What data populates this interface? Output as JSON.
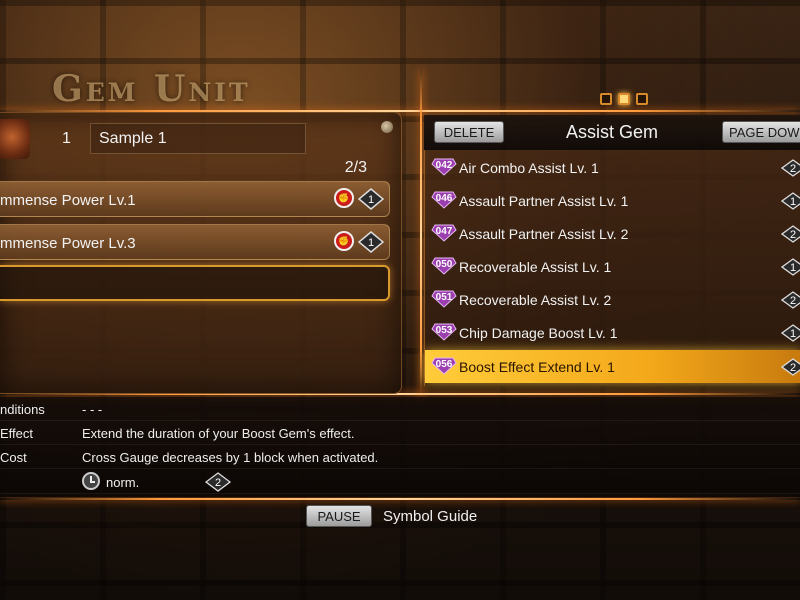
{
  "screen_title": "Gem Unit",
  "set": {
    "number": "1",
    "name": "Sample 1",
    "count": "2/3",
    "slots": [
      {
        "label": "mmense Power Lv.1",
        "cost": "1"
      },
      {
        "label": "mmense Power Lv.3",
        "cost": "1"
      }
    ]
  },
  "assist": {
    "title": "Assist Gem",
    "delete_label": "DELETE",
    "page_down_label": "PAGE DOWN",
    "items": [
      {
        "num": "042",
        "name": "Air Combo Assist Lv. 1",
        "cost": "2"
      },
      {
        "num": "046",
        "name": "Assault Partner Assist Lv. 1",
        "cost": "1"
      },
      {
        "num": "047",
        "name": "Assault Partner Assist Lv. 2",
        "cost": "2"
      },
      {
        "num": "050",
        "name": "Recoverable Assist Lv. 1",
        "cost": "1"
      },
      {
        "num": "051",
        "name": "Recoverable Assist Lv. 2",
        "cost": "2"
      },
      {
        "num": "053",
        "name": "Chip Damage Boost Lv. 1",
        "cost": "1"
      },
      {
        "num": "056",
        "name": "Boost Effect Extend Lv. 1",
        "cost": "2"
      }
    ],
    "selected_index": 6
  },
  "info": {
    "conditions_label": "nditions",
    "conditions_value": "- - -",
    "effect_label": "Effect",
    "effect_value": "Extend the duration of your Boost Gem's effect.",
    "cost_label": "Cost",
    "cost_value": "Cross Gauge decreases by 1 block when activated.",
    "speed_value": "norm.",
    "gem_cost": "2"
  },
  "footer": {
    "pause_label": "PAUSE",
    "guide_label": "Symbol Guide"
  },
  "colors": {
    "accent": "#ff9a3c",
    "selected": "#ffcc3a",
    "gem_purple": "#9b3fb0",
    "category_red": "#cc1b1b"
  },
  "icons": {
    "gem": "purple-gem-icon",
    "cost": "diamond-cost-icon",
    "category": "fist-category-icon",
    "speed": "clock-icon"
  }
}
